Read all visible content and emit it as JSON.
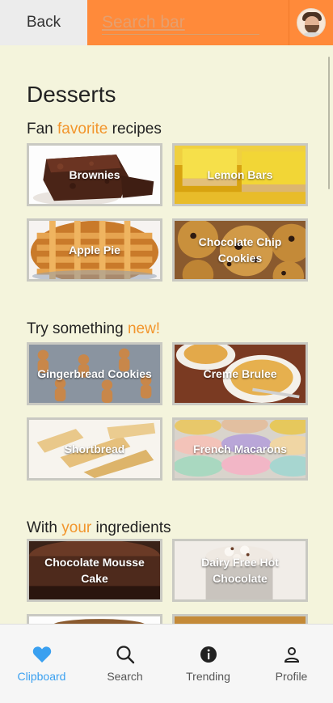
{
  "header": {
    "back_label": "Back",
    "search_placeholder": "Search bar"
  },
  "page": {
    "title": "Desserts"
  },
  "sections": [
    {
      "pre": "Fan ",
      "accent": "favorite",
      "post": " recipes",
      "cards": [
        "Brownies",
        "Lemon Bars",
        "Apple Pie",
        "Chocolate Chip Cookies"
      ]
    },
    {
      "pre": "Try something ",
      "accent": "new!",
      "post": "",
      "cards": [
        "Gingerbread Cookies",
        "Creme Brulee",
        "Shortbread",
        "French Macarons"
      ]
    },
    {
      "pre": "With ",
      "accent": "your",
      "post": " ingredients",
      "cards": [
        "Chocolate Mousse Cake",
        "Dairy Free Hot Chocolate"
      ]
    }
  ],
  "nav": [
    {
      "label": "Clipboard",
      "icon": "heart-icon",
      "active": true
    },
    {
      "label": "Search",
      "icon": "search-icon",
      "active": false
    },
    {
      "label": "Trending",
      "icon": "info-icon",
      "active": false
    },
    {
      "label": "Profile",
      "icon": "person-icon",
      "active": false
    }
  ],
  "colors": {
    "background": "#f4f4dc",
    "header_orange": "#ff8a3a",
    "accent_text": "#f2952c",
    "nav_active": "#3aa0f0"
  }
}
